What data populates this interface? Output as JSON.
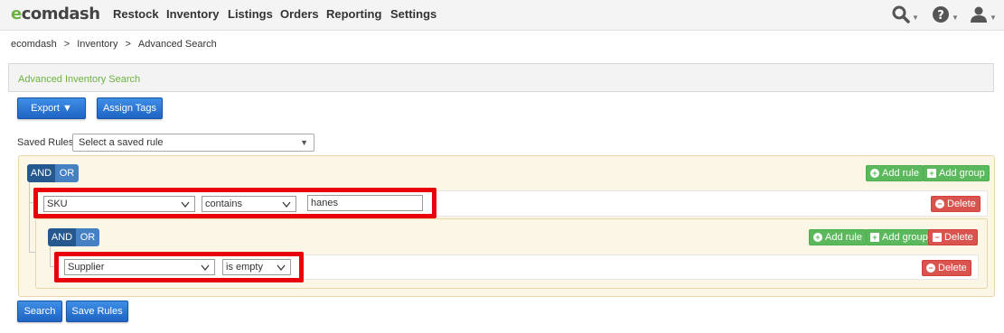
{
  "brand": {
    "logo_prefix": "e",
    "logo_rest": "comdash"
  },
  "nav": {
    "items": [
      "Restock",
      "Inventory",
      "Listings",
      "Orders",
      "Reporting",
      "Settings"
    ]
  },
  "breadcrumb": {
    "items": [
      "ecomdash",
      "Inventory",
      "Advanced Search"
    ],
    "separator": ">"
  },
  "panel": {
    "title": "Advanced Inventory Search"
  },
  "toolbar": {
    "export_label": "Export ▼",
    "assign_tags_label": "Assign Tags"
  },
  "saved_rules": {
    "label": "Saved Rules:",
    "selected": "Select a saved rule"
  },
  "builder": {
    "and_label": "AND",
    "or_label": "OR",
    "add_rule_label": "Add rule",
    "add_group_label": "Add group",
    "delete_label": "Delete",
    "rule1": {
      "field": "SKU",
      "operator": "contains",
      "value": "hanes"
    },
    "rule2": {
      "field": "Supplier",
      "operator": "is empty"
    }
  },
  "footer": {
    "search_label": "Search",
    "save_rules_label": "Save Rules"
  },
  "colors": {
    "brand_green": "#6cb33f",
    "primary_blue": "#1f64c4",
    "success": "#5cb85c",
    "danger": "#d9534f",
    "highlight": "#e8000b"
  },
  "icons": [
    "search-icon",
    "help-icon",
    "user-icon",
    "plus-circle-icon",
    "plus-square-icon",
    "minus-circle-icon",
    "minus-square-icon",
    "chevron-down-icon"
  ]
}
